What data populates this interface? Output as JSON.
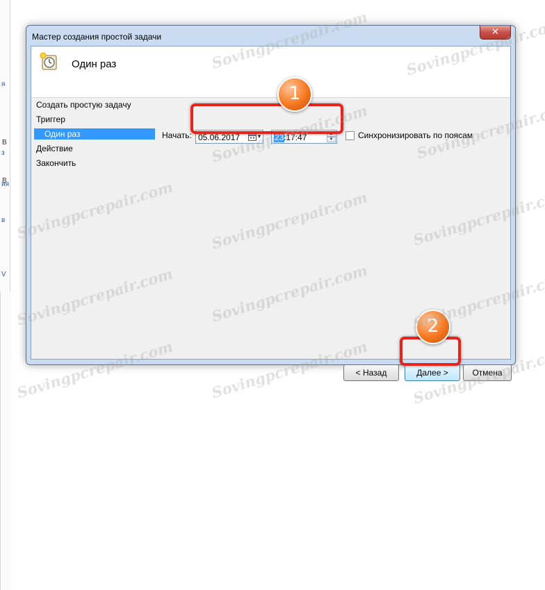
{
  "window": {
    "title": "Мастер создания простой задачи",
    "close_glyph": "✕",
    "header_title": "Один раз",
    "header_icon": "clock-icon"
  },
  "steps": [
    {
      "label": "Создать простую задачу",
      "active": false
    },
    {
      "label": "Триггер",
      "active": false
    },
    {
      "label": "Один раз",
      "active": true
    },
    {
      "label": "Действие",
      "active": false
    },
    {
      "label": "Закончить",
      "active": false
    }
  ],
  "start": {
    "label": "Начать:",
    "date_value": "05.06.2017",
    "time_hours": "23",
    "time_rest": ":17:47"
  },
  "sync": {
    "label": "Синхронизировать по поясам",
    "checked": false
  },
  "buttons": {
    "back": "< Назад",
    "next": "Далее >",
    "cancel": "Отмена"
  },
  "markers": [
    "1",
    "2"
  ],
  "watermark_text": "Sovingpcrepair.com",
  "background_glimpses": {
    "left": [
      "я",
      "з",
      "ия",
      "в",
      "V"
    ],
    "right": [
      "В",
      "В"
    ]
  },
  "colors": {
    "highlight": "#e8231c",
    "marker": "#f5781f",
    "selection": "#3399ff"
  }
}
